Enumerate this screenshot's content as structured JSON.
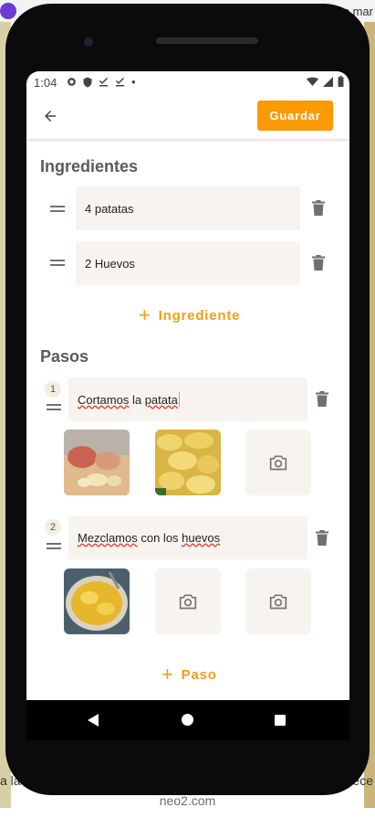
{
  "background": {
    "top_text": "Otras mar",
    "left_text": "a la",
    "right_text": "rece",
    "caption": "neo2.com"
  },
  "status_bar": {
    "time": "1:04",
    "dot": "•"
  },
  "app_bar": {
    "save_label": "Guardar",
    "back_icon": "arrow-back-icon"
  },
  "ingredients": {
    "title": "Ingredientes",
    "items": [
      {
        "value": "4 patatas"
      },
      {
        "value": "2 Huevos"
      }
    ],
    "add_label": "Ingrediente"
  },
  "steps": {
    "title": "Pasos",
    "items": [
      {
        "number": "1",
        "word1": "Cortamos",
        "word2": " la ",
        "word3": "patata",
        "photos": 2
      },
      {
        "number": "2",
        "word1": "Mezclamos",
        "word2": " con los ",
        "word3": "huevos",
        "photos": 1
      }
    ],
    "add_label": "Paso"
  },
  "colors": {
    "accent": "#fb9a05",
    "field_bg": "#f7f4ef"
  }
}
